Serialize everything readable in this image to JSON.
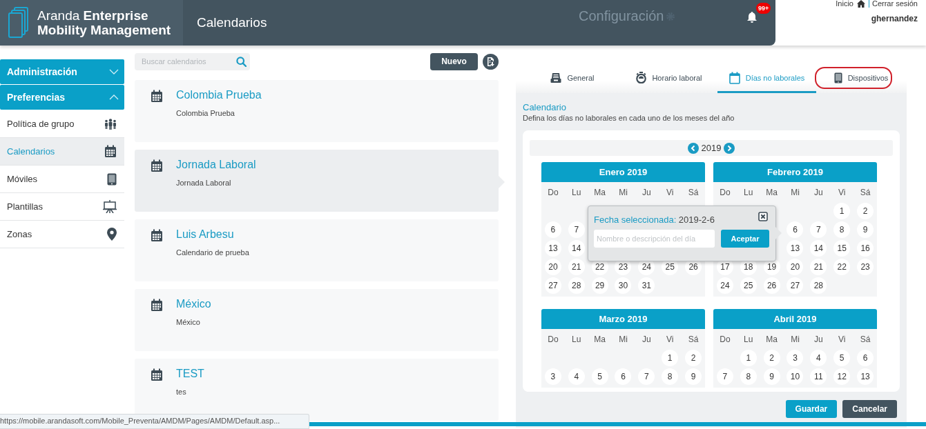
{
  "header": {
    "brand_light": "Aranda",
    "brand_bold": "Enterprise",
    "brand_line2": "Mobility Management",
    "page_title": "Calendarios",
    "center_label": "Configuración",
    "notification_badge": "99+",
    "home_link": "Inicio",
    "logout_link": "Cerrar sesión",
    "username": "ghernandez"
  },
  "sidebar": {
    "sections": [
      {
        "label": "Administración",
        "expanded": false
      },
      {
        "label": "Preferencias",
        "expanded": true,
        "items": [
          {
            "label": "Política de grupo",
            "selected": false
          },
          {
            "label": "Calendarios",
            "selected": true
          },
          {
            "label": "Móviles",
            "selected": false
          },
          {
            "label": "Plantillas",
            "selected": false
          },
          {
            "label": "Zonas",
            "selected": false
          }
        ]
      }
    ]
  },
  "search": {
    "placeholder": "Buscar calendarios"
  },
  "new_button": "Nuevo",
  "calendars": [
    {
      "name": "Colombia Prueba",
      "description": "Colombia Prueba",
      "selected": false
    },
    {
      "name": "Jornada Laboral",
      "description": "Jornada Laboral",
      "selected": true
    },
    {
      "name": "Luis Arbesu",
      "description": "Calendario de prueba",
      "selected": false
    },
    {
      "name": "México",
      "description": "México",
      "selected": false
    },
    {
      "name": "TEST",
      "description": "tes",
      "selected": false
    }
  ],
  "tabs": [
    {
      "label": "General",
      "selected": false,
      "highlighted": false
    },
    {
      "label": "Horario laboral",
      "selected": false,
      "highlighted": false
    },
    {
      "label": "Días no laborales",
      "selected": true,
      "highlighted": false
    },
    {
      "label": "Dispositivos",
      "selected": false,
      "highlighted": true
    }
  ],
  "section": {
    "title": "Calendario",
    "subtitle": "Defina los días no laborales en cada uno de los meses del año"
  },
  "year": "2019",
  "months": [
    {
      "title": "Enero 2019",
      "weekdays": [
        "Do",
        "Lu",
        "Ma",
        "Mi",
        "Ju",
        "Vi",
        "Sá"
      ],
      "weeks": [
        {
          "kind": "covered"
        },
        {
          "kind": "days",
          "right_aligned": false,
          "days": [
            "6",
            "7"
          ]
        },
        {
          "kind": "days",
          "right_aligned": false,
          "days": [
            "13",
            "14"
          ]
        },
        {
          "kind": "days",
          "days": [
            "20",
            "21",
            "22",
            "23",
            "24",
            "25",
            "26"
          ]
        },
        {
          "kind": "days",
          "right_aligned": false,
          "days": [
            "27",
            "28",
            "29",
            "30",
            "31"
          ]
        }
      ]
    },
    {
      "title": "Febrero 2019",
      "weekdays": [
        "Do",
        "Lu",
        "Ma",
        "Mi",
        "Ju",
        "Vi",
        "Sá"
      ],
      "weeks": [
        {
          "kind": "days",
          "right_aligned": true,
          "days": [
            "1",
            "2"
          ]
        },
        {
          "kind": "days",
          "right_aligned": true,
          "days": [
            "6",
            "7",
            "8",
            "9"
          ]
        },
        {
          "kind": "days",
          "right_aligned": true,
          "days": [
            "13",
            "14",
            "15",
            "16"
          ]
        },
        {
          "kind": "days",
          "days": [
            "17",
            "18",
            "19",
            "20",
            "21",
            "22",
            "23"
          ]
        },
        {
          "kind": "days",
          "right_aligned": false,
          "days": [
            "24",
            "25",
            "26",
            "27",
            "28"
          ]
        }
      ]
    },
    {
      "title": "Marzo 2019",
      "weekdays": [
        "Do",
        "Lu",
        "Ma",
        "Mi",
        "Ju",
        "Vi",
        "Sá"
      ],
      "weeks": [
        {
          "kind": "days",
          "right_aligned": true,
          "days": [
            "1",
            "2"
          ]
        },
        {
          "kind": "days",
          "days": [
            "3",
            "4",
            "5",
            "6",
            "7",
            "8",
            "9"
          ]
        }
      ]
    },
    {
      "title": "Abril 2019",
      "weekdays": [
        "Do",
        "Lu",
        "Ma",
        "Mi",
        "Ju",
        "Vi",
        "Sá"
      ],
      "weeks": [
        {
          "kind": "days",
          "right_aligned": true,
          "days": [
            "1",
            "2",
            "3",
            "4",
            "5",
            "6"
          ]
        },
        {
          "kind": "days",
          "days": [
            "7",
            "8",
            "9",
            "10",
            "11",
            "12",
            "13"
          ]
        }
      ]
    }
  ],
  "popup": {
    "label": "Fecha seleccionada:",
    "value": "2019-2-6",
    "placeholder": "Nombre o descripción del día",
    "button": "Aceptar"
  },
  "actions": [
    {
      "label": "Guardar",
      "kind": "primary"
    },
    {
      "label": "Cancelar",
      "kind": "secondary"
    }
  ],
  "status_url": "https://mobile.arandasoft.com/Mobile_Preventa/AMDM/Pages/AMDM/Default.asp..."
}
